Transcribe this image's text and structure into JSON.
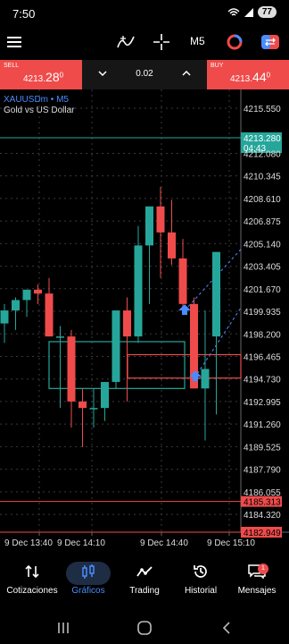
{
  "status": {
    "time": "7:50",
    "battery": "77"
  },
  "toolbar": {
    "items": [
      {
        "name": "menu-icon"
      },
      {
        "name": "indicators-icon"
      },
      {
        "name": "crosshair-icon"
      },
      {
        "name": "timeframe",
        "label": "M5"
      },
      {
        "name": "chart-style-icon"
      },
      {
        "name": "trade-icon"
      }
    ]
  },
  "trade": {
    "sell_label": "SELL",
    "sell_price_main": "4213.",
    "sell_price_big": "28",
    "sell_price_sup": "0",
    "buy_label": "BUY",
    "buy_price_main": "4213.",
    "buy_price_big": "44",
    "buy_price_sup": "0",
    "volume": "0.02"
  },
  "chart": {
    "symbol": "XAUUSDm • M5",
    "description": "Gold vs US Dollar",
    "colors": {
      "up": "#26a69a",
      "down": "#ef4b4b",
      "grid": "#3a3a3a",
      "box_blue": "#26a69a",
      "box_red": "#ef4b4b"
    },
    "price_labels": [
      "4215.550",
      "4213.280",
      "04:43",
      "4212.080",
      "4210.345",
      "4208.610",
      "4206.875",
      "4205.140",
      "4203.405",
      "4201.670",
      "4199.935",
      "4198.200",
      "4196.465",
      "4194.730",
      "4192.995",
      "4191.260",
      "4189.525",
      "4187.790",
      "4186.055",
      "4185.313",
      "4184.320",
      "4182.949"
    ],
    "time_labels": [
      "9 Dec 13:40",
      "9 Dec 14:10",
      "9 Dec 14:40",
      "9 Dec 15:10"
    ]
  },
  "chart_data": {
    "type": "candlestick",
    "x": [
      "13:35",
      "13:40",
      "13:45",
      "13:50",
      "13:55",
      "14:00",
      "14:05",
      "14:10",
      "14:15",
      "14:20",
      "14:25",
      "14:30",
      "14:35",
      "14:40",
      "14:45",
      "14:50",
      "14:55",
      "15:00",
      "15:05",
      "15:10"
    ],
    "open": [
      4199.0,
      4200.0,
      4200.8,
      4201.6,
      4201.3,
      4198.0,
      4198.0,
      4193.0,
      4192.5,
      4192.5,
      4194.5,
      4200.0,
      4198.0,
      4205.0,
      4208.0,
      4206.0,
      4204.0,
      4200.5,
      4194.0,
      4198.0
    ],
    "high": [
      4200.5,
      4201.0,
      4201.5,
      4202.0,
      4202.5,
      4198.8,
      4198.5,
      4194.0,
      4194.0,
      4194.0,
      4197.0,
      4201.0,
      4206.5,
      4206.0,
      4209.5,
      4208.5,
      4205.5,
      4201.0,
      4200.0,
      4201.0
    ],
    "low": [
      4197.5,
      4198.5,
      4199.5,
      4200.5,
      4198.0,
      4192.5,
      4191.0,
      4189.5,
      4191.0,
      4191.5,
      4194.0,
      4193.0,
      4197.5,
      4200.5,
      4202.5,
      4203.5,
      4200.0,
      4194.0,
      4190.0,
      4192.0
    ],
    "close": [
      4200.0,
      4200.8,
      4201.6,
      4201.3,
      4198.0,
      4198.0,
      4193.0,
      4192.5,
      4192.5,
      4194.5,
      4200.0,
      4198.0,
      4205.0,
      4208.0,
      4206.0,
      4204.0,
      4200.5,
      4194.0,
      4195.5,
      4204.5
    ],
    "ylim": [
      4182.949,
      4215.55
    ],
    "bid": 4213.28,
    "levels": [
      4185.313,
      4182.949
    ]
  },
  "nav": {
    "items": [
      {
        "label": "Cotizaciones"
      },
      {
        "label": "Gráficos"
      },
      {
        "label": "Trading"
      },
      {
        "label": "Historial"
      },
      {
        "label": "Mensajes"
      }
    ],
    "badge": "1"
  }
}
